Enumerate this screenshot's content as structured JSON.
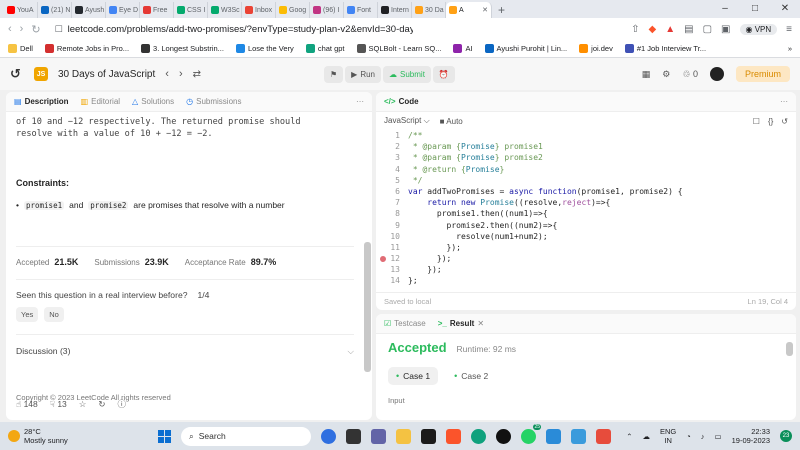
{
  "browser": {
    "tabs": [
      {
        "label": "YouA",
        "color": "#ff0000"
      },
      {
        "label": "(21) N",
        "color": "#0a66c2"
      },
      {
        "label": "Ayush",
        "color": "#24292f"
      },
      {
        "label": "Eye D",
        "color": "#4285f4"
      },
      {
        "label": "Free",
        "color": "#e53935"
      },
      {
        "label": "CSS I",
        "color": "#04aa6d"
      },
      {
        "label": "W3Sc",
        "color": "#04aa6d"
      },
      {
        "label": "Inbox",
        "color": "#ea4335"
      },
      {
        "label": "Goog",
        "color": "#fbbc05"
      },
      {
        "label": "(96) I",
        "color": "#c13584"
      },
      {
        "label": "Font",
        "color": "#4285f4"
      },
      {
        "label": "Intern",
        "color": "#202124"
      },
      {
        "label": "30 Da",
        "color": "#ffa116"
      },
      {
        "label": "A",
        "color": "#ffa116",
        "active": true
      }
    ],
    "url": "leetcode.com/problems/add-two-promises/?envType=study-plan-v2&envId=30-day...",
    "vpn_label": "VPN",
    "bookmarks": [
      {
        "label": "Dell",
        "color": "#f6c343"
      },
      {
        "label": "Remote Jobs in Pro...",
        "color": "#d32f2f"
      },
      {
        "label": "3. Longest Substrin...",
        "color": "#333333"
      },
      {
        "label": "Lose the Very",
        "color": "#1e88e5"
      },
      {
        "label": "chat gpt",
        "color": "#10a37f"
      },
      {
        "label": "SQLBolt - Learn SQ...",
        "color": "#555555"
      },
      {
        "label": "AI",
        "color": "#8e24aa"
      },
      {
        "label": "Ayushi Purohit | Lin...",
        "color": "#0a66c2"
      },
      {
        "label": "joi.dev",
        "color": "#ff8f00"
      },
      {
        "label": "#1 Job Interview Tr...",
        "color": "#3f51b5"
      }
    ]
  },
  "leetcode": {
    "study_badge": "JS",
    "study_title": "30 Days of JavaScript",
    "run_label": "Run",
    "submit_label": "Submit",
    "streak_count": "0",
    "premium_label": "Premium"
  },
  "left_panel": {
    "tabs": [
      "Description",
      "Editorial",
      "Solutions",
      "Submissions"
    ],
    "desc_line1": "of 10 and −12 respectively. The returned promise should",
    "desc_line2": "resolve with a value of 10 + −12 = −2.",
    "constraints_heading": "Constraints:",
    "constraint_code1": "promise1",
    "constraint_and": "and",
    "constraint_code2": "promise2",
    "constraint_text": "are promises that resolve with a number",
    "accepted_label": "Accepted",
    "accepted_value": "21.5K",
    "submissions_label": "Submissions",
    "submissions_value": "23.9K",
    "rate_label": "Acceptance Rate",
    "rate_value": "89.7%",
    "interview_question": "Seen this question in a real interview before?",
    "interview_page": "1/4",
    "yes_label": "Yes",
    "no_label": "No",
    "discussion_label": "Discussion (3)",
    "copyright": "Copyright © 2023 LeetCode All rights reserved",
    "likes": "148",
    "dislikes": "13"
  },
  "code_panel": {
    "title": "Code",
    "language": "JavaScript",
    "mode": "Auto",
    "lines": [
      "/**",
      " * @param {Promise} promise1",
      " * @param {Promise} promise2",
      " * @return {Promise}",
      " */",
      "var addTwoPromises = async function(promise1, promise2) {",
      "    return new Promise((resolve,reject)=>{",
      "      promise1.then((num1)=>{",
      "        promise2.then((num2)=>{",
      "          resolve(num1+num2);",
      "        });",
      "      });",
      "    });",
      "};"
    ],
    "breakpoint_line": 12,
    "saved_text": "Saved to local",
    "cursor_pos": "Ln 19, Col 4"
  },
  "test_panel": {
    "testcase_label": "Testcase",
    "result_label": "Result",
    "status": "Accepted",
    "runtime": "Runtime: 92 ms",
    "cases": [
      "Case 1",
      "Case 2"
    ],
    "input_label": "Input"
  },
  "taskbar": {
    "temp": "28°C",
    "weather": "Mostly sunny",
    "search_label": "Search",
    "lang": "ENG",
    "region": "IN",
    "time": "22:33",
    "date": "19-09-2023",
    "notifications": "23",
    "badge": "25"
  }
}
